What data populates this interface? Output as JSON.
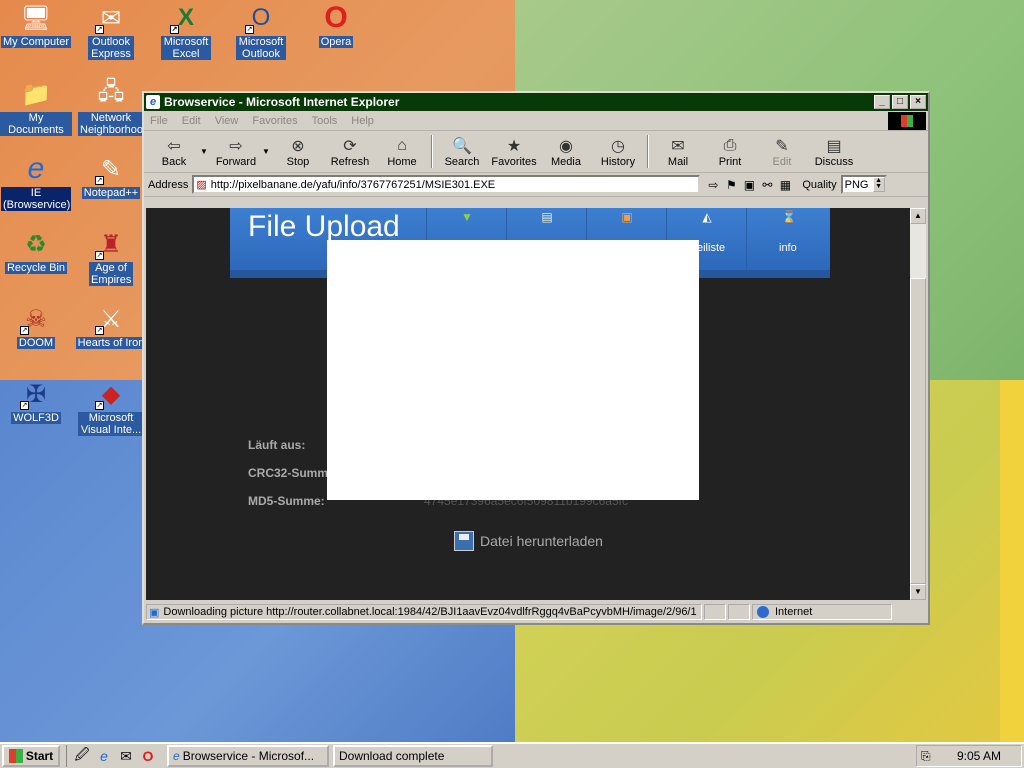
{
  "desktop": {
    "icons": [
      {
        "label": "My Computer",
        "glyph": "🖥"
      },
      {
        "label": "Outlook Express",
        "glyph": "✉"
      },
      {
        "label": "Microsoft Excel",
        "glyph": "X"
      },
      {
        "label": "Microsoft Outlook",
        "glyph": "O"
      },
      {
        "label": "Opera",
        "glyph": "O"
      },
      {
        "label": "My Documents",
        "glyph": "📁"
      },
      {
        "label": "Network Neighborhood",
        "glyph": "🖧"
      },
      {
        "label": "IE (Browservice)",
        "glyph": "e"
      },
      {
        "label": "Notepad++",
        "glyph": "✎"
      },
      {
        "label": "Recycle Bin",
        "glyph": "♻"
      },
      {
        "label": "Age of Empires",
        "glyph": "♜"
      },
      {
        "label": "DOOM",
        "glyph": "☠"
      },
      {
        "label": "Hearts of Iron",
        "glyph": "⚔"
      },
      {
        "label": "WOLF3D",
        "glyph": "✠"
      },
      {
        "label": "Microsoft Visual Inte...",
        "glyph": "◆"
      }
    ]
  },
  "window": {
    "title": "Browservice - Microsoft Internet Explorer",
    "menu": [
      "File",
      "Edit",
      "View",
      "Favorites",
      "Tools",
      "Help"
    ],
    "toolbar": {
      "back": "Back",
      "forward": "Forward",
      "stop": "Stop",
      "refresh": "Refresh",
      "home": "Home",
      "search": "Search",
      "favorites": "Favorites",
      "media": "Media",
      "history": "History",
      "mail": "Mail",
      "print": "Print",
      "edit": "Edit",
      "discuss": "Discuss"
    },
    "address": {
      "label": "Address",
      "url": "http://pixelbanane.de/yafu/info/3767767251/MSIE301.EXE",
      "quality_label": "Quality",
      "quality_value": "PNG"
    },
    "page": {
      "brand": "File Upload",
      "nav": [
        "eiliste",
        "info"
      ],
      "rows": [
        {
          "label": "Läuft aus:",
          "value": ""
        },
        {
          "label": "CRC32-Summe:",
          "value": ""
        },
        {
          "label": "MD5-Summe:",
          "value": "4745e17396a5ec6f509811b199c6a5fc"
        }
      ],
      "download": "Datei herunterladen"
    },
    "status": {
      "text": "Downloading picture http://router.collabnet.local:1984/42/BJI1aavEvz04vdlfrRggq4vBaPcyvbMH/image/2/96/1",
      "zone": "Internet"
    }
  },
  "taskbar": {
    "start": "Start",
    "tasks": [
      "Browservice - Microsof...",
      "Download complete"
    ],
    "clock": "9:05 AM"
  }
}
